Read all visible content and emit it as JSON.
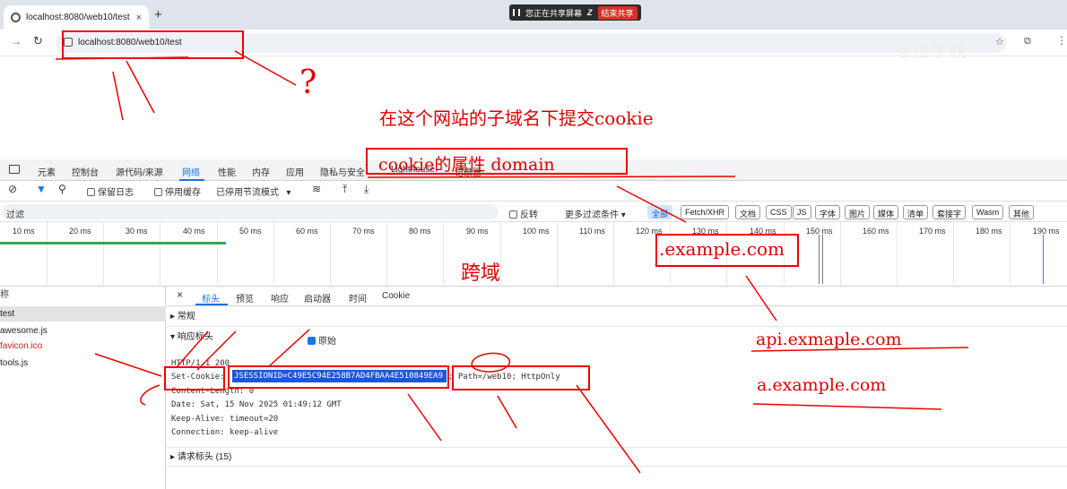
{
  "browser": {
    "tab_title": "localhost:8080/web10/test",
    "tab_close": "×",
    "new_tab": "+",
    "share_status": "您正在共享屏幕",
    "share_stop": "结束共享",
    "share_sig": "Z",
    "url": "localhost:8080/web10/test",
    "watermark": "考拉学院",
    "icons": [
      "forward-icon",
      "reload-icon",
      "site-info-icon",
      "star-icon",
      "extensions-icon",
      "menu-icon"
    ]
  },
  "devtools": {
    "tabs": [
      "元素",
      "控制台",
      "源代码/来源",
      "网络",
      "性能",
      "内存",
      "应用",
      "隐私与安全",
      "Lighthouse",
      "记录器"
    ],
    "active_tab": "网络",
    "toolbar": {
      "preserve_log": "保留日志",
      "disable_cache": "停用缓存",
      "throttle": "已停用节流模式"
    },
    "filter": {
      "placeholder": "过滤",
      "invert": "反转",
      "more_filters": "更多过滤条件",
      "chips": [
        "全部",
        "Fetch/XHR",
        "文档",
        "CSS",
        "JS",
        "字体",
        "图片",
        "媒体",
        "清单",
        "套接字",
        "Wasm",
        "其他"
      ]
    },
    "timeline_ticks": [
      "10 ms",
      "20 ms",
      "30 ms",
      "40 ms",
      "50 ms",
      "60 ms",
      "70 ms",
      "80 ms",
      "90 ms",
      "100 ms",
      "110 ms",
      "120 ms",
      "130 ms",
      "140 ms",
      "150 ms",
      "160 ms",
      "170 ms",
      "180 ms",
      "190 ms"
    ],
    "requests": {
      "header": "称",
      "items": [
        "test",
        "awesome.js",
        "favicon.ico",
        "tools.js"
      ]
    },
    "detail_tabs": [
      "标头",
      "预览",
      "响应",
      "启动器",
      "时间",
      "Cookie"
    ],
    "close": "×",
    "sections": {
      "general": "常规",
      "response_headers": "响应标头",
      "raw": "原始",
      "request_headers": "请求标头 (15)"
    },
    "raw_headers": {
      "status": "HTTP/1.1 200",
      "set_cookie_name": "Set-Cookie:",
      "set_cookie_value": "JSESSIONID=C49E5C94E258B7AD4FBAA4E510849EA9",
      "set_cookie_attrs": "; Path=/web10; HttpOnly",
      "content_length": "Content-Length: 0",
      "date": "Date: Sat, 15 Nov 2025 01:49:12 GMT",
      "keep_alive": "Keep-Alive: timeout=20",
      "connection": "Connection: keep-alive"
    }
  },
  "annotations": {
    "question_mark": "?",
    "subdomain_note": "在这个网站的子域名下提交cookie",
    "domain_attr": "cookie的属性 domain",
    "domain_value": ".example.com",
    "cross_domain": "跨域",
    "sub1": "api.exmaple.com",
    "sub2": "a.example.com"
  },
  "colors": {
    "annotation_red": "#e00000",
    "accent_blue": "#1a73e8",
    "selection_blue": "#1a56db"
  }
}
